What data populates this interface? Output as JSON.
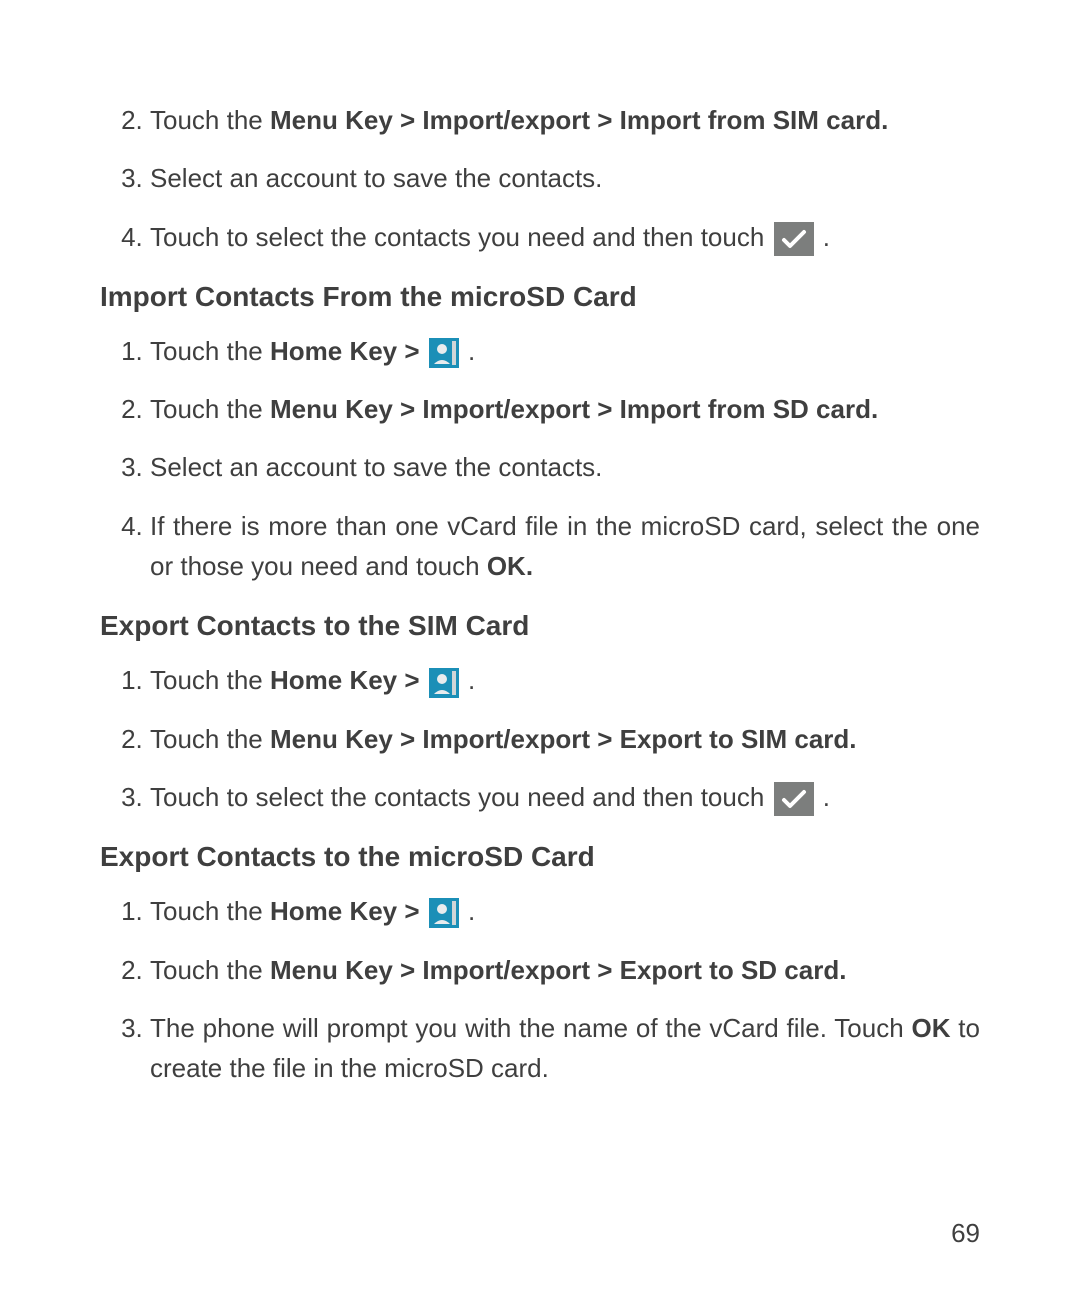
{
  "page_number": "69",
  "topBlock": {
    "step2_pre": "Touch the ",
    "step2_bold": "Menu Key > Import/export > Import from SIM card.",
    "step3": "Select an account to save the contacts.",
    "step4_pre": "Touch to select the contacts you need and then touch ",
    "step4_post": " ."
  },
  "section1": {
    "heading": "Import Contacts From the microSD Card",
    "step1_pre": "Touch the ",
    "step1_bold": "Home Key > ",
    "step1_post": " .",
    "step2_pre": "Touch the ",
    "step2_bold": "Menu Key > Import/export > Import from SD card.",
    "step3": "Select an account to save the contacts.",
    "step4_pre": "If there is more than one vCard file in the microSD card, select the one or those you need and touch ",
    "step4_bold": "OK."
  },
  "section2": {
    "heading": "Export Contacts to the SIM Card",
    "step1_pre": "Touch the ",
    "step1_bold": "Home Key > ",
    "step1_post": " .",
    "step2_pre": "Touch the ",
    "step2_bold": "Menu Key > Import/export > Export to SIM card.",
    "step3_pre": "Touch to select the contacts you need and then touch ",
    "step3_post": " ."
  },
  "section3": {
    "heading": "Export Contacts to the microSD Card",
    "step1_pre": "Touch the ",
    "step1_bold": "Home Key > ",
    "step1_post": " .",
    "step2_pre": "Touch the ",
    "step2_bold": "Menu Key > Import/export > Export to SD card.",
    "step3_pre": "The phone will prompt you with the name of the vCard file. Touch ",
    "step3_bold": "OK",
    "step3_post": " to create the file in the microSD card."
  }
}
